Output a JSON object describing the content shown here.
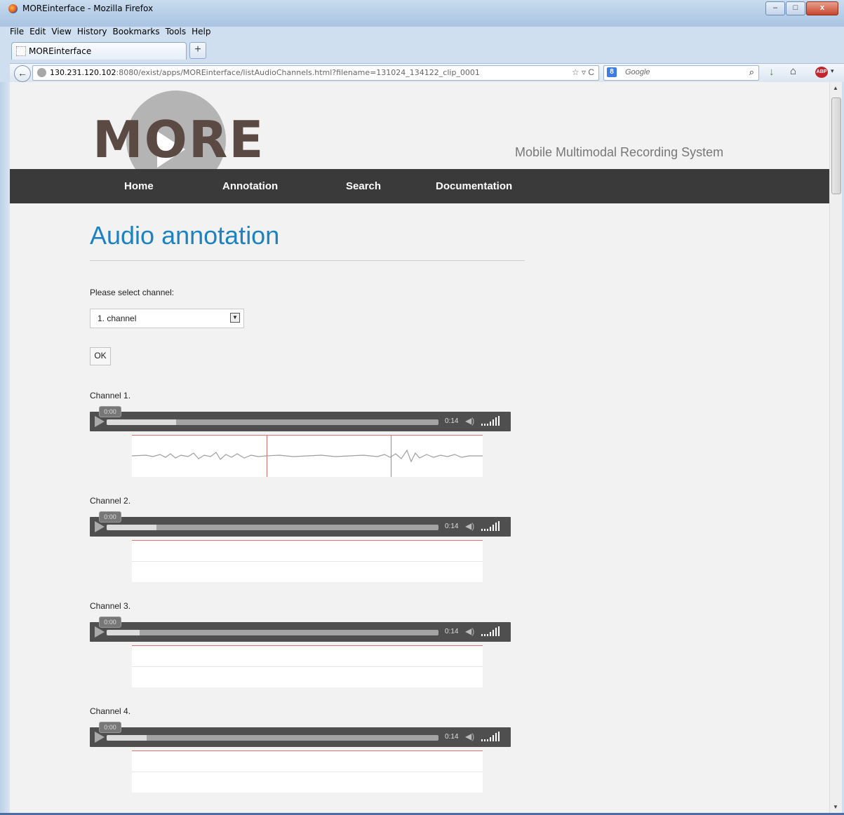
{
  "window": {
    "title": "MOREinterface - Mozilla Firefox",
    "buttons": {
      "minimize": "–",
      "maximize": "□",
      "close": "x"
    }
  },
  "menubar": [
    "File",
    "Edit",
    "View",
    "History",
    "Bookmarks",
    "Tools",
    "Help"
  ],
  "tab": {
    "label": "MOREinterface",
    "new_tab": "+"
  },
  "navbar": {
    "back": "←",
    "url_host": "130.231.120.102",
    "url_rest": ":8080/exist/apps/MOREinterface/listAudioChannels.html?filename=131024_134122_clip_0001",
    "url_icons": "☆ ▿ C",
    "search_badge": "8",
    "search_placeholder": "Google",
    "search_icon": "⌕",
    "download_icon": "↓",
    "home_icon": "⌂",
    "abp_label": "ABP",
    "abp_caret": "▾"
  },
  "site": {
    "logo_text": "MORE",
    "tagline": "Mobile Multimodal Recording System",
    "nav": [
      "Home",
      "Annotation",
      "Search",
      "Documentation"
    ]
  },
  "content": {
    "title": "Audio annotation",
    "select_label": "Please select channel:",
    "select_value": "1. channel",
    "select_arrow": "▼",
    "ok_label": "OK"
  },
  "channels": [
    {
      "label": "Channel 1.",
      "time_tip": "0:00",
      "duration": "0:14",
      "buffered_fraction": 0.21,
      "has_waveform": true
    },
    {
      "label": "Channel 2.",
      "time_tip": "0:00",
      "duration": "0:14",
      "buffered_fraction": 0.15,
      "has_waveform": false
    },
    {
      "label": "Channel 3.",
      "time_tip": "0:00",
      "duration": "0:14",
      "buffered_fraction": 0.1,
      "has_waveform": false
    },
    {
      "label": "Channel 4.",
      "time_tip": "0:00",
      "duration": "0:14",
      "buffered_fraction": 0.12,
      "has_waveform": false
    }
  ],
  "player_icons": {
    "mute": "◀)"
  },
  "colors": {
    "accent_title": "#1c82c0",
    "nav_bg": "#3a3a3a",
    "marker": "#e07070",
    "player_bg": "#4f4f4f"
  }
}
